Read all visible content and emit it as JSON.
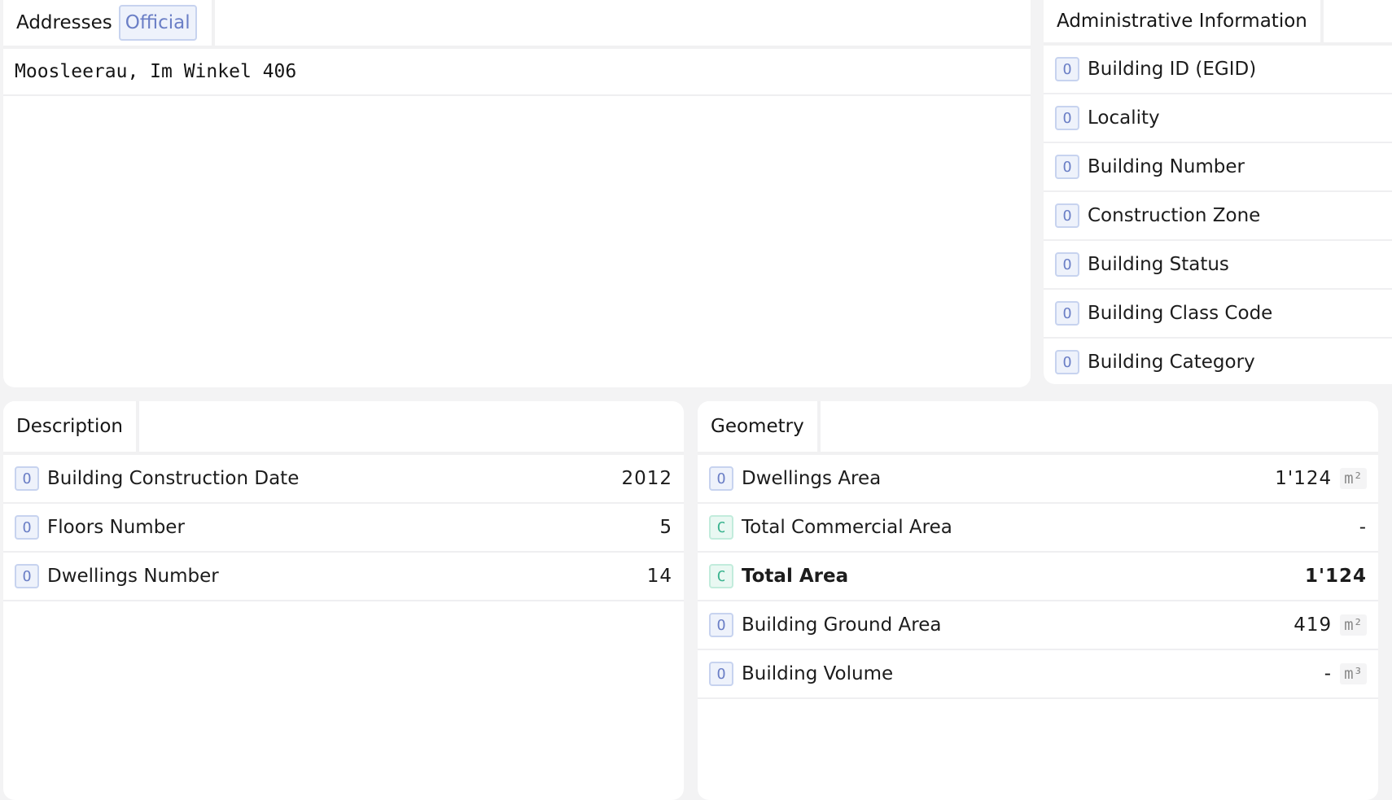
{
  "addresses": {
    "tab_label": "Addresses",
    "badge_label": "Official",
    "items": [
      "Moosleerau, Im Winkel 406"
    ]
  },
  "admin": {
    "tab_label": "Administrative Information",
    "rows": [
      {
        "tag": "O",
        "label": "Building ID (EGID)"
      },
      {
        "tag": "O",
        "label": "Locality"
      },
      {
        "tag": "O",
        "label": "Building Number"
      },
      {
        "tag": "O",
        "label": "Construction Zone"
      },
      {
        "tag": "O",
        "label": "Building Status"
      },
      {
        "tag": "O",
        "label": "Building Class Code"
      },
      {
        "tag": "O",
        "label": "Building Category"
      }
    ]
  },
  "description": {
    "tab_label": "Description",
    "rows": [
      {
        "tag": "O",
        "label": "Building Construction Date",
        "value": "2012"
      },
      {
        "tag": "O",
        "label": "Floors Number",
        "value": "5"
      },
      {
        "tag": "O",
        "label": "Dwellings Number",
        "value": "14"
      }
    ]
  },
  "geometry": {
    "tab_label": "Geometry",
    "rows": [
      {
        "tag": "O",
        "label": "Dwellings Area",
        "value": "1'124",
        "unit": "m²"
      },
      {
        "tag": "C",
        "label": "Total Commercial Area",
        "value": "-",
        "unit": ""
      },
      {
        "tag": "C",
        "label": "Total Area",
        "value": "1'124",
        "unit": ""
      },
      {
        "tag": "O",
        "label": "Building Ground Area",
        "value": "419",
        "unit": "m²"
      },
      {
        "tag": "O",
        "label": "Building Volume",
        "value": "-",
        "unit": "m³"
      }
    ]
  }
}
